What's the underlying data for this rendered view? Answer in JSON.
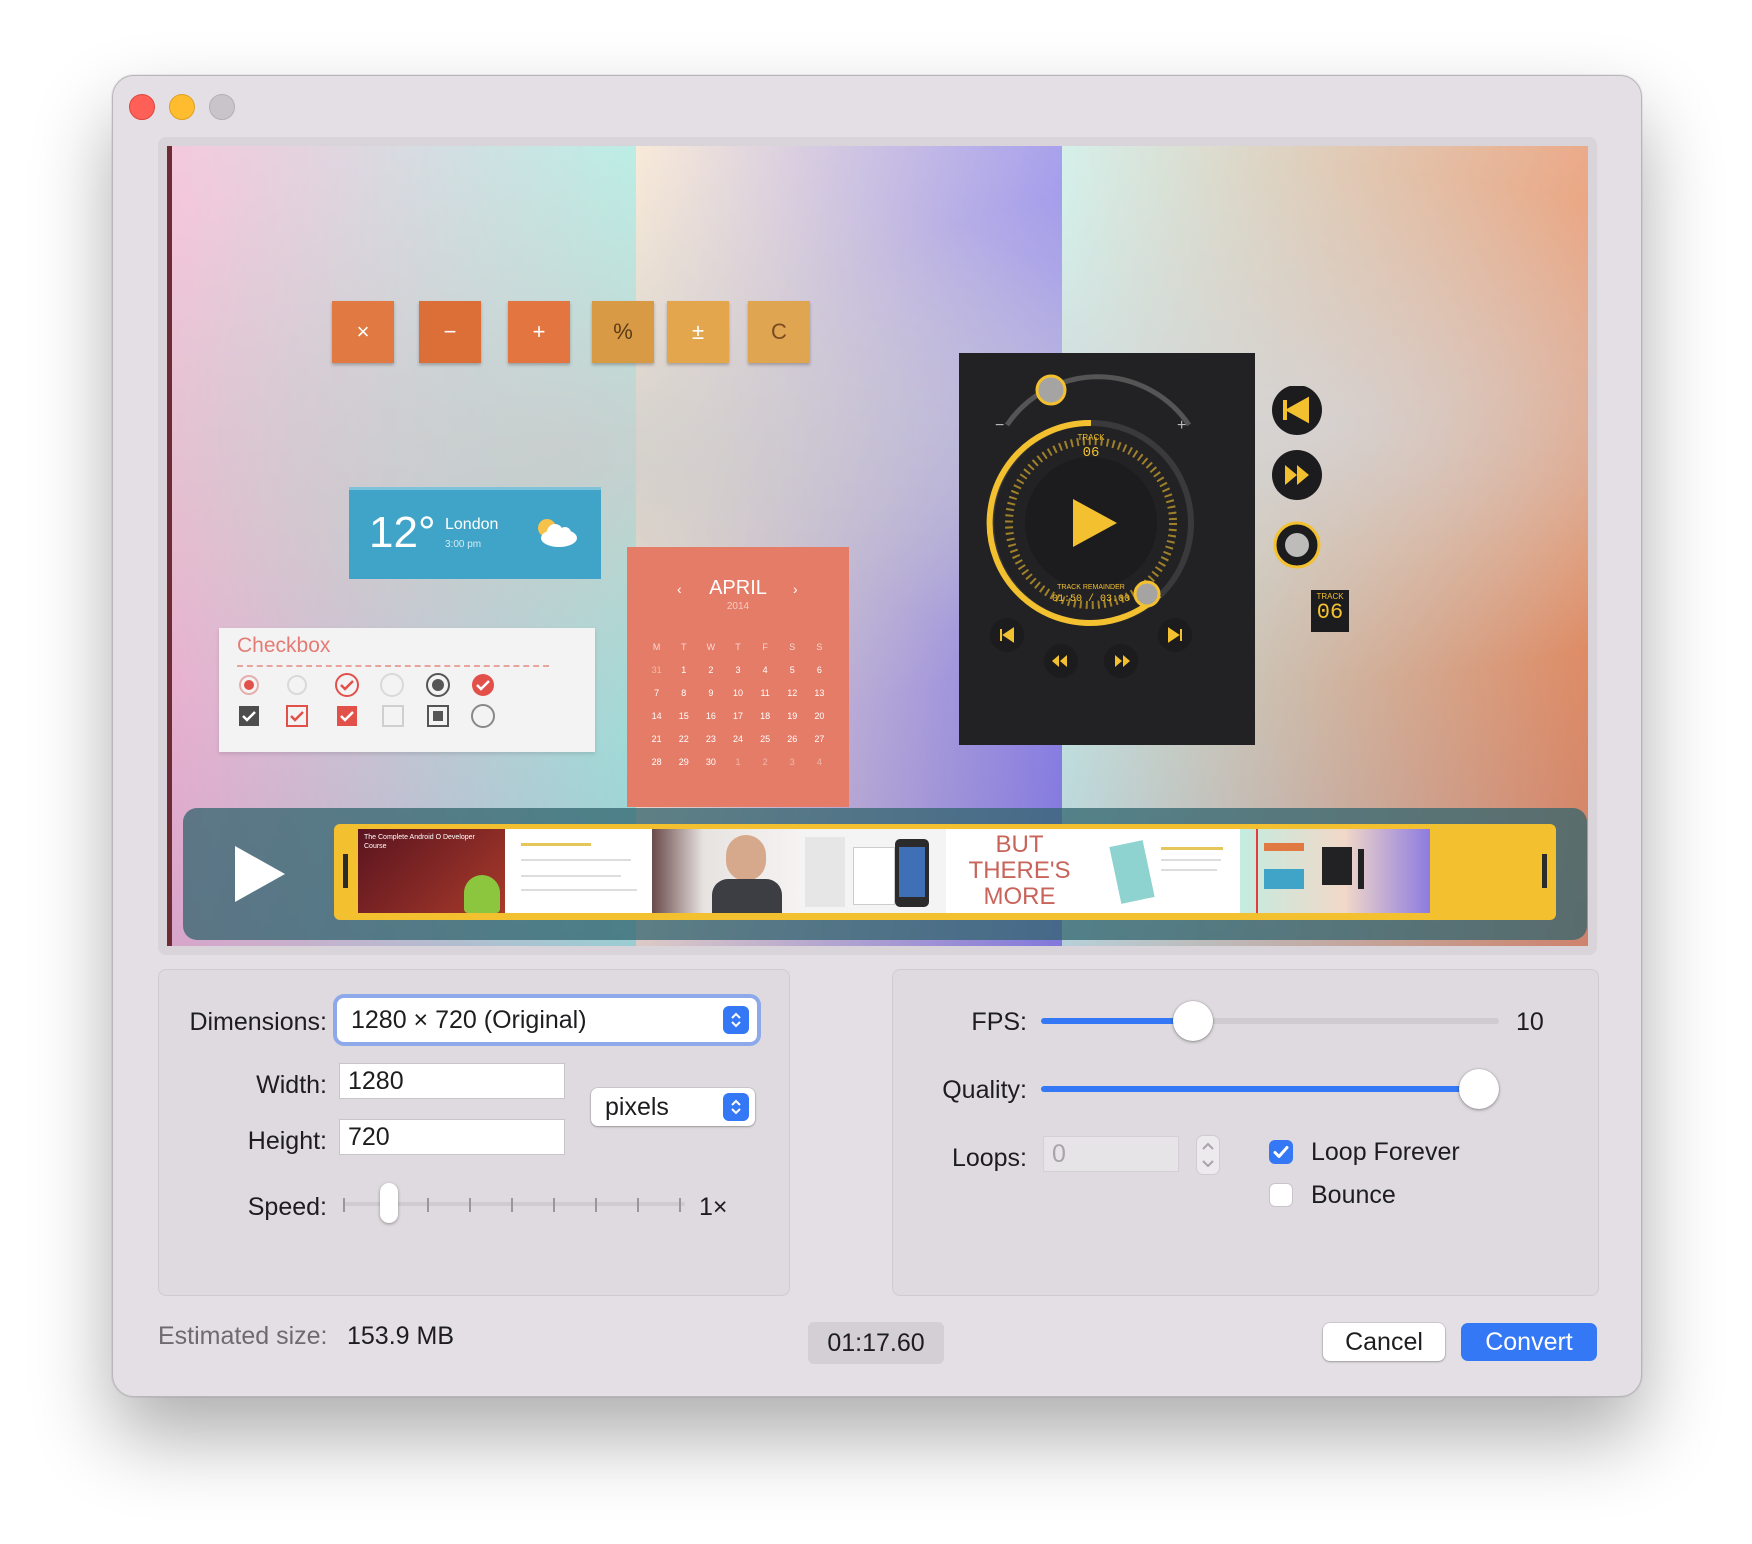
{
  "window": {
    "title": ""
  },
  "preview": {
    "calc_buttons": [
      "×",
      "−",
      "+",
      "%",
      "±",
      "C"
    ],
    "weather": {
      "temp": "12°",
      "city": "London",
      "time": "3:00 pm"
    },
    "checkbox_title": "Checkbox",
    "calendar": {
      "month": "APRIL",
      "year": "2014",
      "weekdays": [
        "M",
        "T",
        "W",
        "T",
        "F",
        "S",
        "S"
      ],
      "days": [
        "31",
        "1",
        "2",
        "3",
        "4",
        "5",
        "6",
        "7",
        "8",
        "9",
        "10",
        "11",
        "12",
        "13",
        "14",
        "15",
        "16",
        "17",
        "18",
        "19",
        "20",
        "21",
        "22",
        "23",
        "24",
        "25",
        "26",
        "27",
        "28",
        "29",
        "30",
        "1",
        "2",
        "3",
        "4"
      ]
    },
    "player": {
      "track_label": "TRACK",
      "track_number": "06",
      "remainder_label": "TRACK REMAINDER",
      "remainder_time": "01:50 / 03:00"
    },
    "side_track_label": "TRACK",
    "side_track_number": "06",
    "filmstrip": {
      "thumb1_title": "The Complete Android O Developer Course",
      "thumb5_text": "BUT THERE'S MORE"
    }
  },
  "settings": {
    "dimensions_label": "Dimensions:",
    "dimensions_value": "1280 × 720 (Original)",
    "width_label": "Width:",
    "width_value": "1280",
    "height_label": "Height:",
    "height_value": "720",
    "units_value": "pixels",
    "speed_label": "Speed:",
    "speed_value": "1×",
    "speed_level_fraction": 0.12,
    "fps_label": "FPS:",
    "fps_value": "10",
    "fps_fraction": 0.33,
    "quality_label": "Quality:",
    "quality_fraction": 1.0,
    "loops_label": "Loops:",
    "loops_placeholder": "0",
    "loop_forever_label": "Loop Forever",
    "loop_forever_checked": true,
    "bounce_label": "Bounce",
    "bounce_checked": false
  },
  "footer": {
    "estimated_label": "Estimated size:",
    "estimated_value": "153.9 MB",
    "duration": "01:17.60",
    "cancel_label": "Cancel",
    "convert_label": "Convert"
  },
  "colors": {
    "accent": "#3478f6",
    "strip_frame": "#f3c12f",
    "calendar": "#e57c67",
    "calc_orange": "#e07a42"
  }
}
